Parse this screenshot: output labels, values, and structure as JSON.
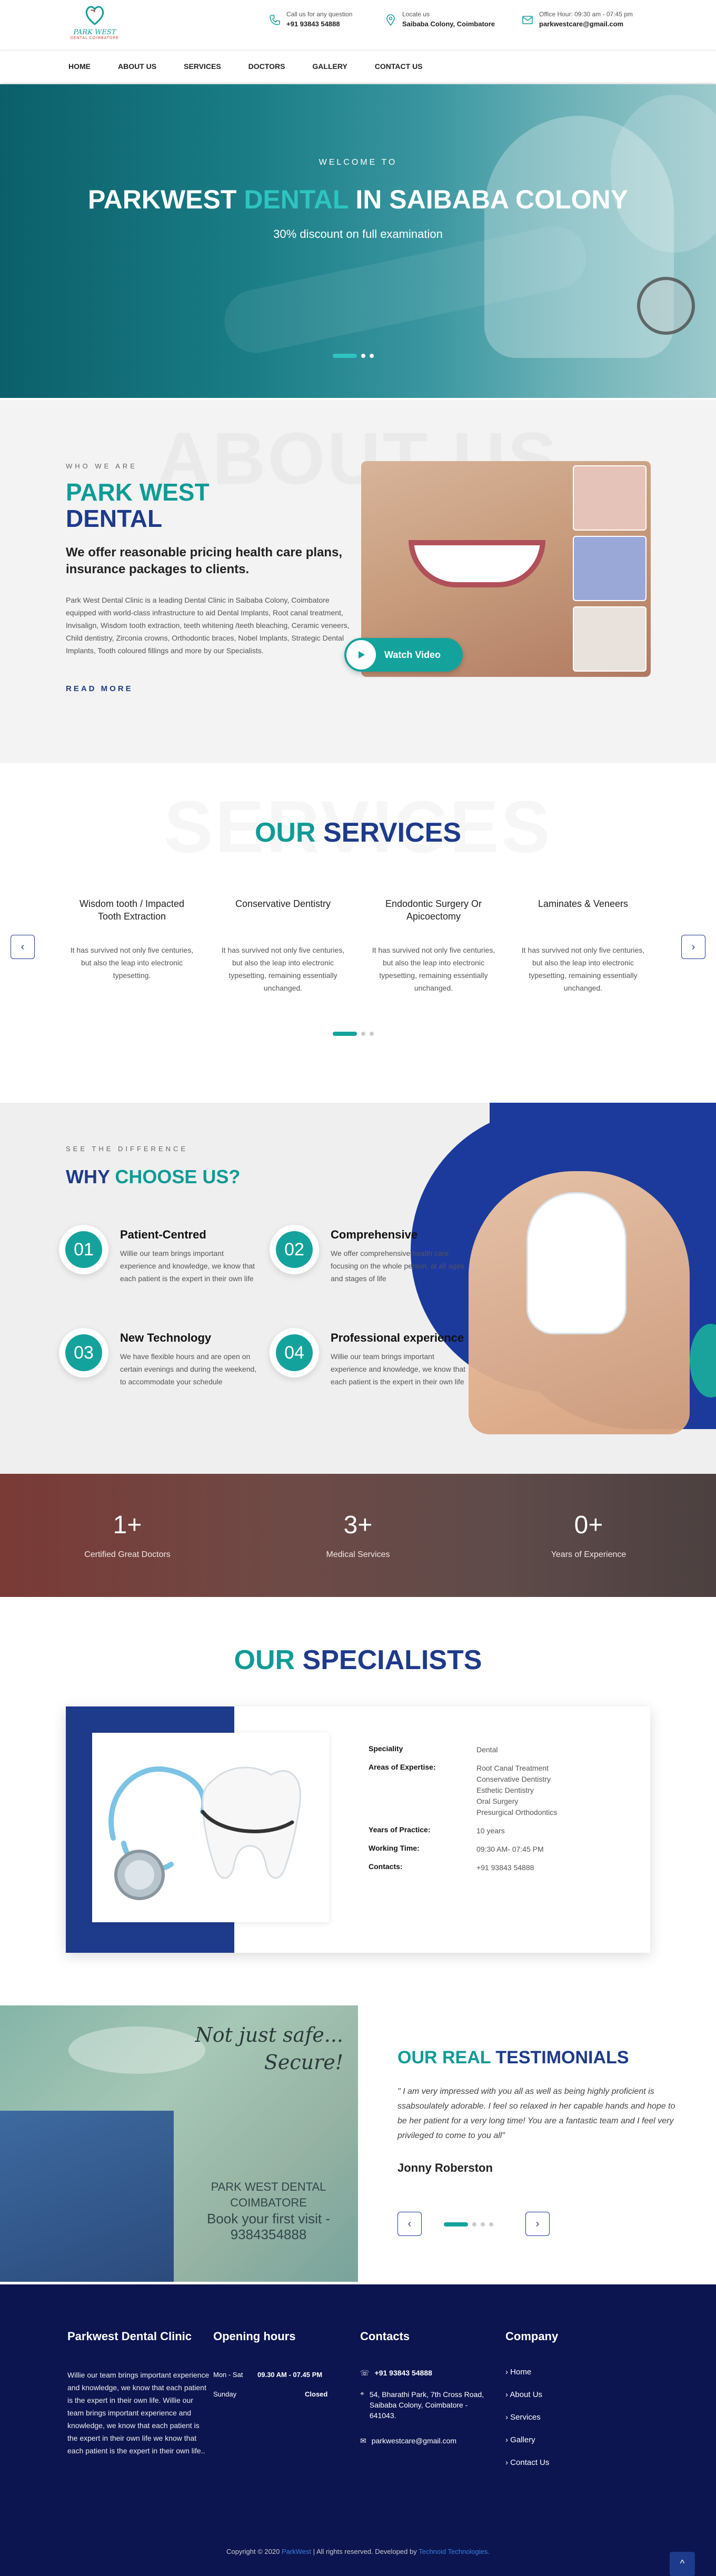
{
  "header": {
    "logo_text": "PARK WEST",
    "logo_sub": "DENTAL COIMBATORE",
    "phone_label": "Call us for any question",
    "phone": "+91 93843 54888",
    "locate_label": "Locate us",
    "locate": "Saibaba Colony, Coimbatore",
    "hours_label": "Office Hour: 09:30 am - 07:45 pm",
    "email": "parkwestcare@gmail.com"
  },
  "nav": [
    "HOME",
    "ABOUT US",
    "SERVICES",
    "DOCTORS",
    "GALLERY",
    "CONTACT US"
  ],
  "hero": {
    "welcome": "WELCOME TO",
    "title_a": "PARKWEST ",
    "title_b": "DENTAL",
    "title_c": " IN SAIBABA COLONY",
    "subtitle": "30% discount on full examination"
  },
  "about": {
    "ghost": "ABOUT US",
    "sub": "WHO WE ARE",
    "title_a": "PARK WEST",
    "title_b": "DENTAL",
    "lead": "We offer reasonable pricing health care plans, insurance packages to clients.",
    "body": "Park West Dental Clinic is a leading Dental Clinic in Saibaba Colony, Coimbatore equipped with world-class infrastructure to aid Dental Implants, Root canal treatment, Invisalign, Wisdom tooth extraction, teeth whitening /teeth bleaching, Ceramic veneers, Child dentistry, Zirconia crowns, Orthodontic braces, Nobel Implants, Strategic Dental Implants, Tooth coloured fillings and more by our Specialists.",
    "read_more": "READ MORE",
    "watch_video": "Watch Video"
  },
  "services": {
    "ghost": "SERVICES",
    "title_a": "OUR ",
    "title_b": "SERVICES",
    "items": [
      {
        "title": "Wisdom tooth / Impacted Tooth Extraction",
        "text": "It has survived not only five centuries, but also the leap into electronic typesetting."
      },
      {
        "title": "Conservative Dentistry",
        "text": "It has survived not only five centuries, but also the leap into electronic typesetting, remaining essentially unchanged."
      },
      {
        "title": "Endodontic Surgery Or Apicoectomy",
        "text": "It has survived not only five centuries, but also the leap into electronic typesetting, remaining essentially unchanged."
      },
      {
        "title": "Laminates & Veneers",
        "text": "It has survived not only five centuries, but also the leap into electronic typesetting, remaining essentially unchanged."
      }
    ],
    "prev": "‹",
    "next": "›"
  },
  "why": {
    "sub": "SEE THE DIFFERENCE",
    "title_a": "WHY ",
    "title_b": "CHOOSE US?",
    "items": [
      {
        "num": "01",
        "title": "Patient-Centred",
        "text": "Willie our team brings important experience and knowledge, we know that each patient is the expert in their own life"
      },
      {
        "num": "02",
        "title": "Comprehensive",
        "text": "We offer comprehensive health care focusing on the whole person, at all ages and stages of life"
      },
      {
        "num": "03",
        "title": "New Technology",
        "text": "We have flexible hours and are open on certain evenings and during the weekend, to accommodate your schedule"
      },
      {
        "num": "04",
        "title": "Professional experience",
        "text": "Willie our team brings important experience and knowledge, we know that each patient is the expert in their own life"
      }
    ]
  },
  "counters": [
    {
      "value": "1+",
      "label": "Certified Great Doctors"
    },
    {
      "value": "3+",
      "label": "Medical Services"
    },
    {
      "value": "0+",
      "label": "Years of Experience"
    }
  ],
  "specialists": {
    "title_a": "OUR ",
    "title_b": "SPECIALISTS",
    "speciality_label": "Speciality",
    "speciality": "Dental",
    "expertise_label": "Areas of Expertise:",
    "expertise": [
      "Root Canal Treatment",
      "Conservative Dentistry",
      "Esthetic Dentistry",
      "Oral Surgery",
      "Presurgical Orthodontics"
    ],
    "years_label": "Years of Practice:",
    "years": "10 years",
    "time_label": "Working Time:",
    "time": "09:30 AM- 07:45 PM",
    "contacts_label": "Contacts:",
    "contacts": "+91 93843 54888"
  },
  "testimonials": {
    "script_1": "Not just safe...",
    "script_2": "Secure!",
    "brand_1": "PARK WEST DENTAL",
    "brand_2": "COIMBATORE",
    "brand_3": "Book your first visit -",
    "brand_4": "9384354888",
    "title_a": "OUR REAL ",
    "title_b": "TESTIMONIALS",
    "quote": "\" I am very impressed with you all as well as being highly proficient is ssabsoulately adorable. I feel so relaxed in her capable hands and hope to be her patient for a very long time! You are a fantastic team and I feel very privileged to come to you all\"",
    "name": "Jonny Roberston",
    "prev": "‹",
    "next": "›"
  },
  "footer": {
    "about_title": "Parkwest Dental Clinic",
    "about_text": "Willie our team brings important experience and knowledge, we know that each patient is the expert in their own life. Willie our team brings important experience and knowledge, we know that each patient is the expert in their own life we know that each patient is the expert in their own life..",
    "hours_title": "Opening hours",
    "hours": [
      {
        "day": "Mon - Sat",
        "time": "09.30 AM - 07.45 PM"
      },
      {
        "day": "Sunday",
        "time": "Closed"
      }
    ],
    "contacts_title": "Contacts",
    "phone": "+91 93843 54888",
    "address": "54, Bharathi Park, 7th Cross Road, Saibaba Colony, Coimbatore - 641043.",
    "email": "parkwestcare@gmail.com",
    "company_title": "Company",
    "links": [
      "Home",
      "About Us",
      "Services",
      "Gallery",
      "Contact Us"
    ],
    "copy_a": "Copyright © 2020 ",
    "copy_b": "ParkWest",
    "copy_c": " | All rights reserved. Developed by ",
    "copy_d": "Technoid Technologies.",
    "to_top": "^"
  },
  "colors": {
    "teal": "#0f9b96",
    "navy": "#1e3a8a",
    "footer": "#0c1550"
  }
}
